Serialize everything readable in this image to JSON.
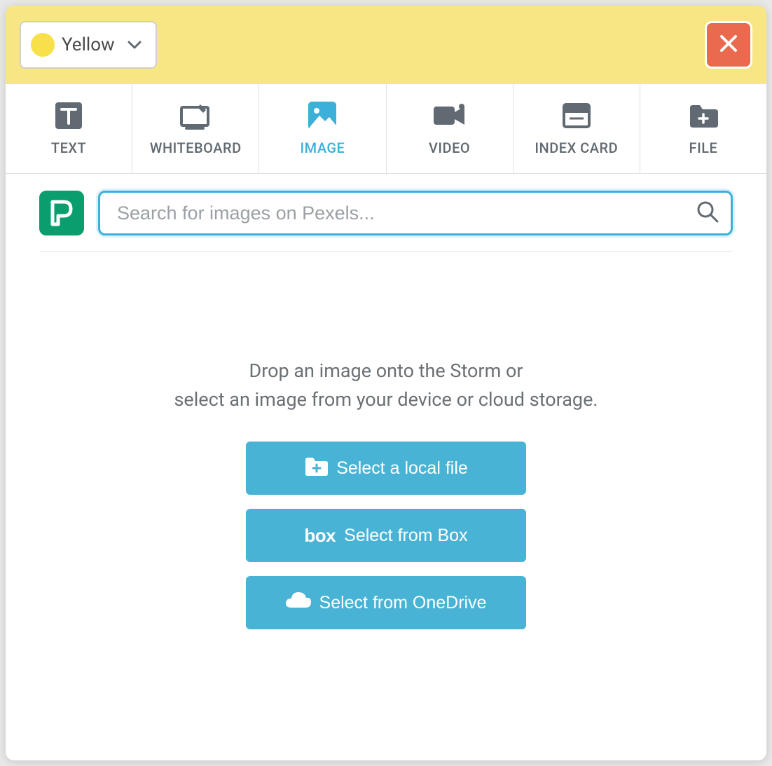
{
  "colors": {
    "accent": "#3db0d9",
    "header_bg": "#f7e683",
    "yellow_swatch": "#f7e04a",
    "close_btn": "#e96a4f",
    "btn_bg": "#49b3d6",
    "pexels": "#0a9e6f",
    "tab_icon": "#616a72"
  },
  "header": {
    "color_label": "Yellow"
  },
  "tabs": [
    {
      "id": "text",
      "label": "TEXT"
    },
    {
      "id": "whiteboard",
      "label": "WHITEBOARD"
    },
    {
      "id": "image",
      "label": "IMAGE",
      "active": true
    },
    {
      "id": "video",
      "label": "VIDEO"
    },
    {
      "id": "indexcard",
      "label": "INDEX CARD"
    },
    {
      "id": "file",
      "label": "FILE"
    }
  ],
  "search": {
    "placeholder": "Search for images on Pexels..."
  },
  "instructions": {
    "line1": "Drop an image onto the Storm or",
    "line2": "select an image from your device or cloud storage."
  },
  "buttons": {
    "local": "Select a local file",
    "box_prefix": "box",
    "box": "Select from Box",
    "onedrive": "Select from OneDrive"
  }
}
